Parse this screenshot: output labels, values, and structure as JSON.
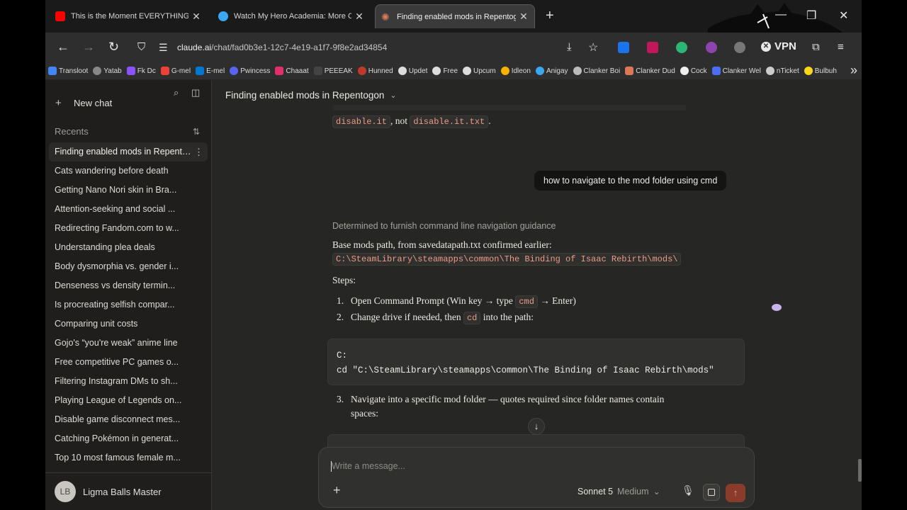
{
  "browser": {
    "tabs": [
      {
        "title": "This is the Moment EVERYTHING Fell A",
        "color": "#ff0000"
      },
      {
        "title": "Watch My Hero Academia: More Onli",
        "color": "#3aa8f0"
      },
      {
        "title": "Finding enabled mods in Repentogon",
        "color": "#d97757"
      }
    ],
    "url_domain": "claude.ai",
    "url_path": "/chat/fad0b3e1-12c7-4e19-a1f7-9f8e2ad34854",
    "vpn_label": "VPN",
    "bookmarks": [
      "Transloot",
      "Yatab",
      "Fk Dc",
      "G-mel",
      "E-mel",
      "Pwincess",
      "Chaaat",
      "PEEEAK",
      "Hunned",
      "Updet",
      "Free",
      "Upcum",
      "Idleon",
      "Anigay",
      "Clanker Boi",
      "Clanker Dud",
      "Cock",
      "Clanker Wel",
      "nTicket",
      "Bulbuh"
    ]
  },
  "sidebar": {
    "new_chat": "New chat",
    "recents_label": "Recents",
    "chats": [
      "Finding enabled mods in Repentogon",
      "Cats wandering before death",
      "Getting Nano Nori skin in Bra...",
      "Attention-seeking and social ...",
      "Redirecting Fandom.com to w...",
      "Understanding plea deals",
      "Body dysmorphia vs. gender i...",
      "Denseness vs density termin...",
      "Is procreating selfish compar...",
      "Comparing unit costs",
      "Gojo's “you're weak” anime line",
      "Free competitive PC games o...",
      "Filtering Instagram DMs to sh...",
      "Playing League of Legends on...",
      "Disable game disconnect mes...",
      "Catching Pokémon in generat...",
      "Top 10 most famous female m..."
    ],
    "user_initials": "LB",
    "user_name": "Ligma Balls Master"
  },
  "main": {
    "title": "Finding enabled mods in Repentogon",
    "prev_code_a": "disable.it",
    "prev_sep": ", not ",
    "prev_code_b": "disable.it.txt",
    "prev_end": ".",
    "user_message": "how to navigate to the mod folder using cmd",
    "thinking": "Determined to furnish command line navigation guidance",
    "base_text": "Base mods path, from savedatapath.txt confirmed earlier:",
    "base_path": "C:\\SteamLibrary\\steamapps\\common\\The Binding of Isaac Rebirth\\mods\\",
    "steps_label": "Steps:",
    "step1_num": "1.",
    "step1_a": "Open Command Prompt (Win key → type ",
    "step1_code": "cmd",
    "step1_b": " → Enter)",
    "step2_num": "2.",
    "step2_a": "Change drive if needed, then ",
    "step2_code": "cd",
    "step2_b": " into the path:",
    "code_line1": "C:",
    "code_line2": "cd \"C:\\SteamLibrary\\steamapps\\common\\The Binding of Isaac Rebirth\\mods\"",
    "step3_num": "3.",
    "step3_line1": "Navigate into a specific mod folder — quotes required since folder names contain",
    "step3_line2": "spaces:"
  },
  "composer": {
    "placeholder": "Write a message...",
    "model": "Sonnet 5",
    "effort": "Medium"
  }
}
